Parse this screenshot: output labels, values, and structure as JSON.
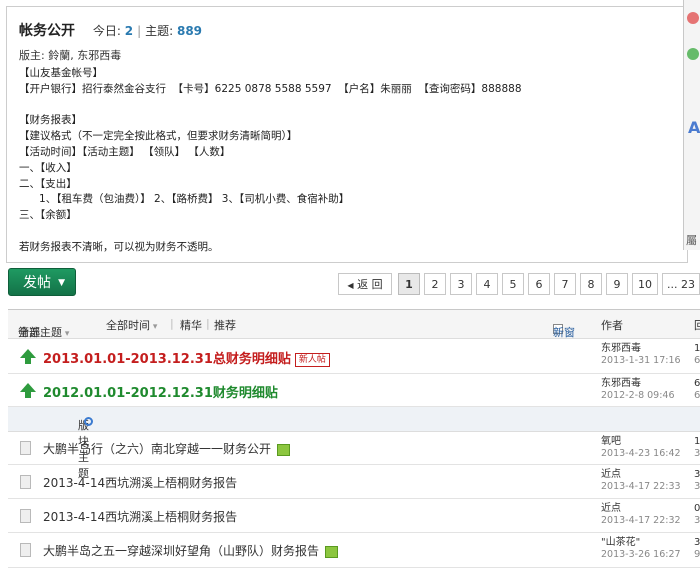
{
  "forum": {
    "title": "帐务公开",
    "today_label": "今日:",
    "today_count": "2",
    "topics_label": "主题:",
    "topics_count": "889",
    "moderators": "版主: 鈴蘭, 东邪西毒",
    "body_text": "【山友基金帐号】\n【开户银行】招行泰然金谷支行  【卡号】6225 0878 5588 5597  【户名】朱丽丽  【查询密码】888888\n\n【财务报表】\n【建议格式（不一定完全按此格式，但要求财务清晰简明）】\n【活动时间】【活动主题】 【领队】 【人数】\n一、【收入】\n二、【支出】\n      1、【租车费（包油费）】 2、【路桥费】 3、【司机小费、食宿补助】\n三、【余额】\n\n若财务报表不清晰，可以视为财务不透明。"
  },
  "side_widget": {
    "label": "屬"
  },
  "toolbar": {
    "post_label": "发帖",
    "prev_label": "返 回",
    "pages": [
      "1",
      "2",
      "3",
      "4",
      "5",
      "6",
      "7",
      "8",
      "9",
      "10",
      "... 23"
    ],
    "current_page": "1"
  },
  "filter": {
    "prefix": "筛选:",
    "topics": "全部主题",
    "time": "全部时间",
    "digest": "精华",
    "recommend": "推荐",
    "new_window": "新窗",
    "author_col": "作者",
    "reply_col": "回"
  },
  "sticky": [
    {
      "title": "2013.01.01-2013.12.31总财务明细贴",
      "badge": "新人帖",
      "author": "东邪西毒",
      "date": "2013-1-31 17:16",
      "replies": "1",
      "views": "6",
      "color": "red"
    },
    {
      "title": "2012.01.01-2012.12.31财务明细贴",
      "author": "东邪西毒",
      "date": "2012-2-8 09:46",
      "replies": "6",
      "views": "6",
      "color": "green"
    }
  ],
  "section_label": "版块主题",
  "threads": [
    {
      "title": "大鹏半岛行（之六）南北穿越一一财务公开",
      "author": "氧吧",
      "date": "2013-4-23 16:42",
      "replies": "1",
      "views": "3"
    },
    {
      "title": "2013-4-14西坑溯溪上梧桐财务报告",
      "author": "近点",
      "date": "2013-4-17 22:33",
      "replies": "3",
      "views": "3"
    },
    {
      "title": "2013-4-14西坑溯溪上梧桐财务报告",
      "author": "近点",
      "date": "2013-4-17 22:32",
      "replies": "0",
      "views": "3"
    },
    {
      "title": "大鹏半岛之五一穿越深圳好望角（山野队）财务报告",
      "author": "\"山茶花\"",
      "date": "2013-3-26 16:27",
      "replies": "3",
      "views": "9"
    }
  ]
}
